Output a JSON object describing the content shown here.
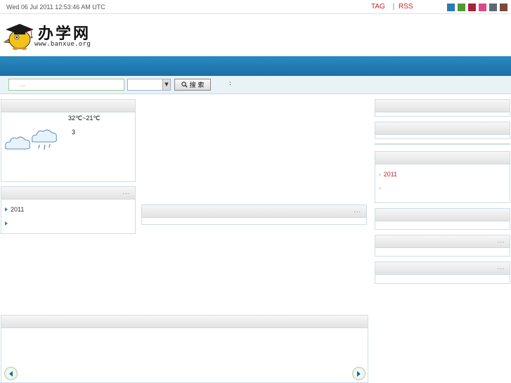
{
  "topbar": {
    "date": "Wed 06 Jul 2011 12:53:46 AM UTC",
    "tag_link": "TAG",
    "rss_link": "RSS",
    "separator": "|",
    "skin_colors": [
      "#2a7ab8",
      "#4f9a32",
      "#a4243f",
      "#d84a8a",
      "#5b6a72",
      "#7a4a3a"
    ]
  },
  "logo": {
    "text": "办学网",
    "url": "www.banxue.org",
    "icon": "graduate-bird-logo"
  },
  "search": {
    "placeholder": "...",
    "button_label": "搜 索",
    "button_icon": "magnifier-icon",
    "extra": ":"
  },
  "weather": {
    "temp": "32℃~21℃",
    "level": "3",
    "icon": "rain-cloud-icon"
  },
  "left_list": {
    "more": "...",
    "items": [
      "2011",
      ""
    ]
  },
  "center_panel": {
    "more": "..."
  },
  "right_list": {
    "items": [
      "2011",
      ""
    ],
    "highlight_color": "#cc2222"
  },
  "right_panel_5": {
    "more": "..."
  },
  "right_panel_6": {
    "more": "..."
  }
}
